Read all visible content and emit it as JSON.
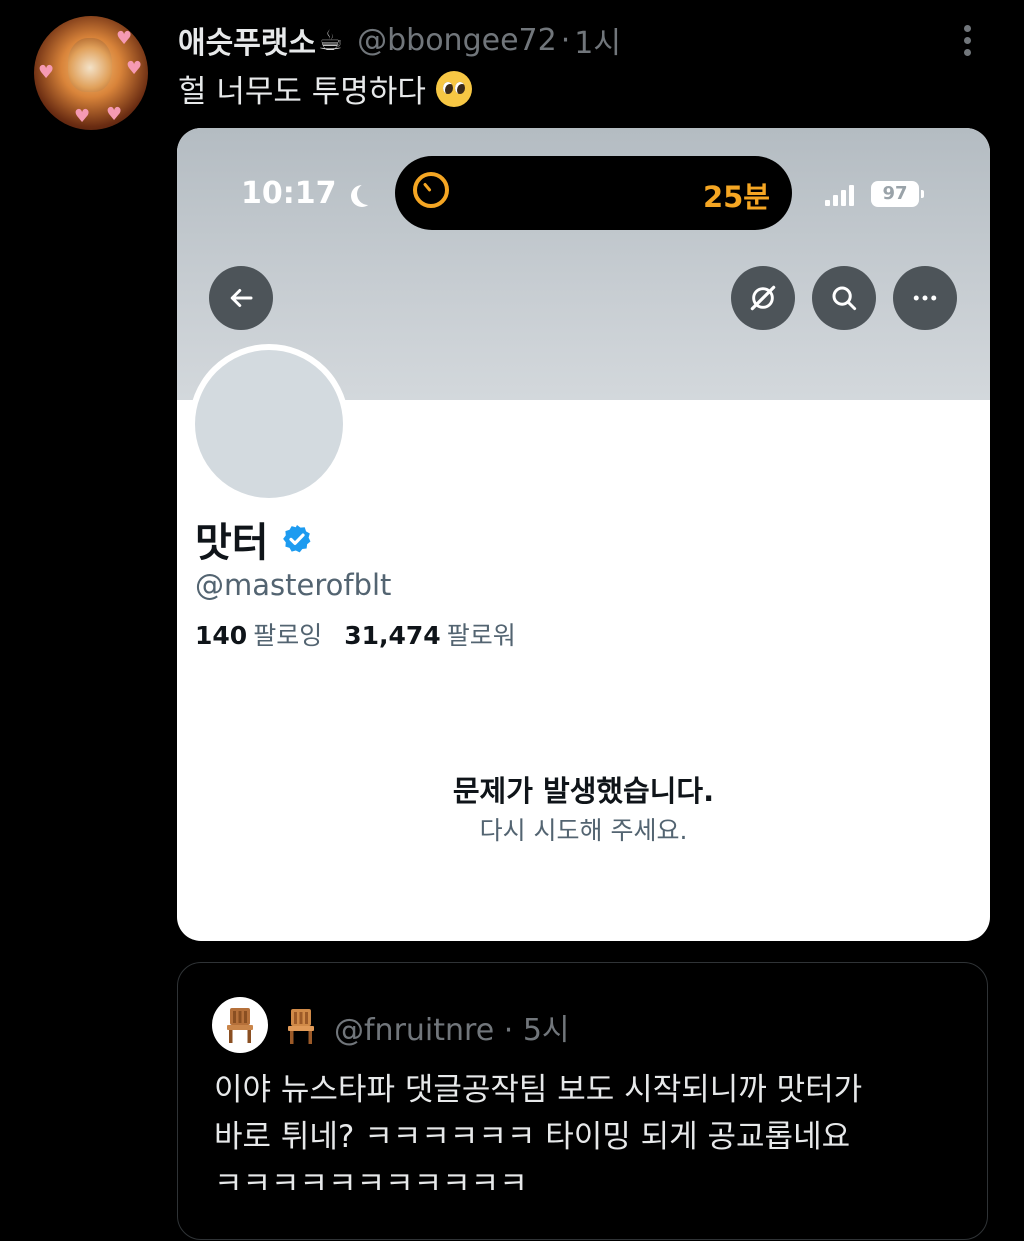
{
  "tweet": {
    "display_name": "애슷푸랫소",
    "handle": "@bbongee72",
    "separator": "·",
    "time": "1시",
    "text": "헐 너무도 투명하다",
    "icons": {
      "name_emoji": "coffee-cup-icon",
      "text_emoji": "pleading-face-icon",
      "menu": "more-vertical-icon"
    }
  },
  "embedded_screenshot": {
    "status_bar": {
      "time": "10:17",
      "focus_icon": "moon-icon",
      "timer_text": "25분",
      "battery": "97"
    },
    "profile": {
      "name": "맛터",
      "handle": "@masterofblt",
      "following_count": "140",
      "following_label": "팔로잉",
      "followers_count": "31,474",
      "followers_label": "팔로워"
    },
    "error": {
      "title": "문제가 발생했습니다.",
      "subtitle": "다시 시도해 주세요."
    },
    "colors": {
      "banner": "#c6ccd1",
      "timer_accent": "#f5a623",
      "verified": "#1d9bf0"
    }
  },
  "quote": {
    "handle": "@fnruitnre",
    "separator": "·",
    "time": "5시",
    "avatar_icon": "chair-icon",
    "text": "이야 뉴스타파 댓글공작팀 보도 시작되니까 맛터가\n바로 튀네? ㅋㅋㅋㅋㅋㅋ 타이밍 되게 공교롭네요\nㅋㅋㅋㅋㅋㅋㅋㅋㅋㅋㅋ"
  }
}
